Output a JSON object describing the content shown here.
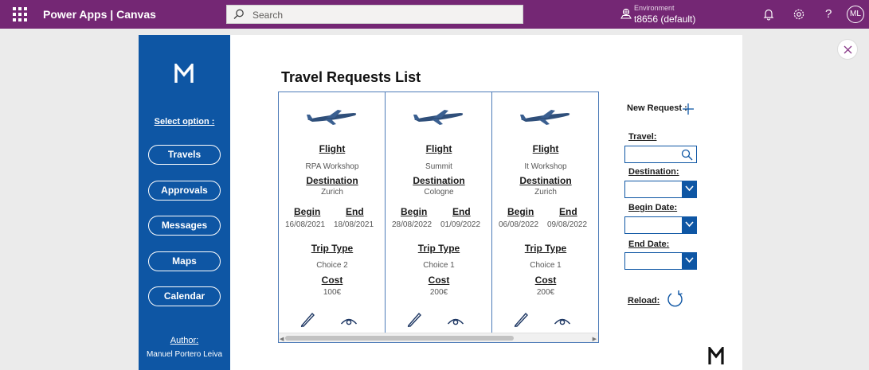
{
  "topbar": {
    "app_title": "Power Apps  |  Canvas",
    "search_placeholder": "Search",
    "environment_label": "Environment",
    "environment_value": "t8656 (default)",
    "help_glyph": "?",
    "avatar_initials": "ML",
    "icons": [
      "waffle-icon",
      "search-icon",
      "environment-icon",
      "bell-icon",
      "gear-icon",
      "help-icon"
    ]
  },
  "sidebar": {
    "select_label": "Select option :",
    "nav": [
      "Travels",
      "Approvals",
      "Messages",
      "Maps",
      "Calendar"
    ],
    "author_label": "Author:",
    "author_name": "Manuel Portero Leiva",
    "color": "#0e56a4"
  },
  "main": {
    "title": "Travel Requests List"
  },
  "gallery": {
    "labels": {
      "flight": "Flight",
      "destination": "Destination",
      "begin": "Begin",
      "end": "End",
      "trip_type": "Trip Type",
      "cost": "Cost"
    },
    "cards": [
      {
        "flight": "RPA Workshop",
        "destination": "Zurich",
        "begin": "16/08/2021",
        "end": "18/08/2021",
        "trip_type": "Choice 2",
        "cost": "100€"
      },
      {
        "flight": "Summit",
        "destination": "Cologne",
        "begin": "28/08/2022",
        "end": "01/09/2022",
        "trip_type": "Choice 1",
        "cost": "200€"
      },
      {
        "flight": "It Workshop",
        "destination": "Zurich",
        "begin": "06/08/2022",
        "end": "09/08/2022",
        "trip_type": "Choice 1",
        "cost": "200€"
      }
    ]
  },
  "form": {
    "new_request_label": "New Request :",
    "travel_label": "Travel:",
    "travel_value": "",
    "destination_label": "Destination:",
    "destination_value": "",
    "begin_date_label": "Begin Date:",
    "begin_date_value": "",
    "end_date_label": "End Date:",
    "end_date_value": "",
    "reload_label": "Reload:"
  },
  "colors": {
    "topbar": "#742774",
    "accent": "#0e56a4"
  }
}
